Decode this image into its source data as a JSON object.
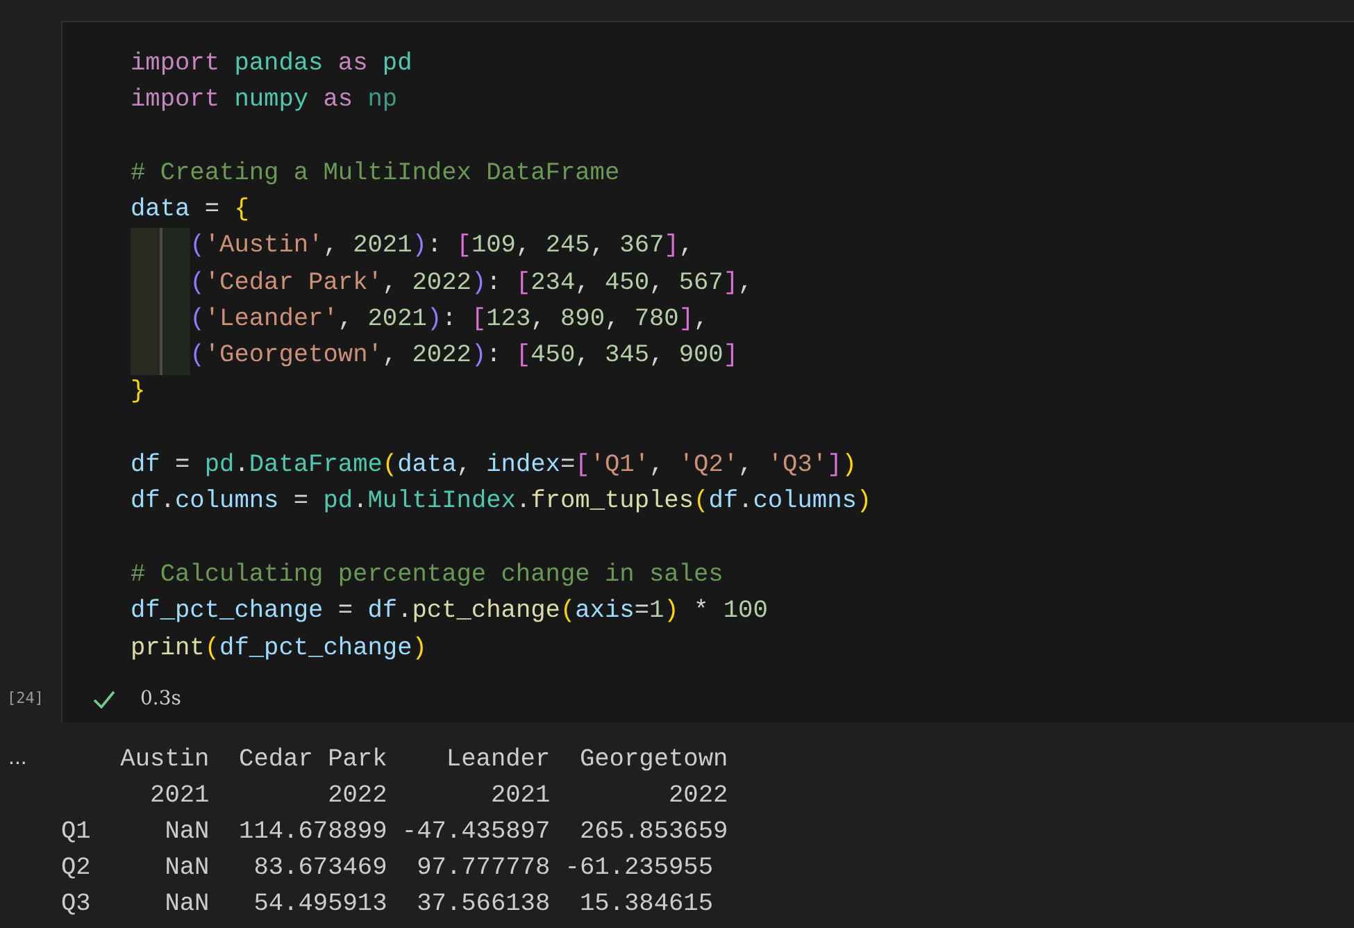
{
  "cell": {
    "execution_count": "[24]",
    "status": {
      "succeeded": true,
      "duration": "0.3s"
    },
    "code_blocks": [
      [
        {
          "indent": false,
          "tokens": [
            {
              "kind": "kw",
              "text": "import"
            },
            {
              "kind": "module",
              "text": " pandas"
            },
            {
              "kind": "kw",
              "text": " as"
            },
            {
              "kind": "module",
              "text": " pd"
            }
          ]
        },
        {
          "indent": false,
          "tokens": [
            {
              "kind": "kw",
              "text": "import"
            },
            {
              "kind": "module",
              "text": " numpy"
            },
            {
              "kind": "kw",
              "text": " as"
            },
            {
              "kind": "unused",
              "text": " np"
            }
          ]
        }
      ],
      [
        {
          "indent": false,
          "tokens": [
            {
              "kind": "comment",
              "text": "# Creating a MultiIndex DataFrame"
            }
          ]
        },
        {
          "indent": false,
          "tokens": [
            {
              "kind": "var",
              "text": "data"
            },
            {
              "kind": "plain",
              "text": " = "
            },
            {
              "kind": "b1",
              "text": "{"
            }
          ]
        },
        {
          "indent": true,
          "tokens": [
            {
              "kind": "b3",
              "text": "("
            },
            {
              "kind": "str",
              "text": "'Austin'"
            },
            {
              "kind": "plain",
              "text": ", "
            },
            {
              "kind": "num",
              "text": "2021"
            },
            {
              "kind": "b3",
              "text": ")"
            },
            {
              "kind": "plain",
              "text": ": "
            },
            {
              "kind": "b2",
              "text": "["
            },
            {
              "kind": "num",
              "text": "109"
            },
            {
              "kind": "plain",
              "text": ", "
            },
            {
              "kind": "num",
              "text": "245"
            },
            {
              "kind": "plain",
              "text": ", "
            },
            {
              "kind": "num",
              "text": "367"
            },
            {
              "kind": "b2",
              "text": "]"
            },
            {
              "kind": "plain",
              "text": ","
            }
          ]
        },
        {
          "indent": true,
          "tokens": [
            {
              "kind": "b3",
              "text": "("
            },
            {
              "kind": "str",
              "text": "'Cedar Park'"
            },
            {
              "kind": "plain",
              "text": ", "
            },
            {
              "kind": "num",
              "text": "2022"
            },
            {
              "kind": "b3",
              "text": ")"
            },
            {
              "kind": "plain",
              "text": ": "
            },
            {
              "kind": "b2",
              "text": "["
            },
            {
              "kind": "num",
              "text": "234"
            },
            {
              "kind": "plain",
              "text": ", "
            },
            {
              "kind": "num",
              "text": "450"
            },
            {
              "kind": "plain",
              "text": ", "
            },
            {
              "kind": "num",
              "text": "567"
            },
            {
              "kind": "b2",
              "text": "]"
            },
            {
              "kind": "plain",
              "text": ","
            }
          ]
        },
        {
          "indent": true,
          "tokens": [
            {
              "kind": "b3",
              "text": "("
            },
            {
              "kind": "str",
              "text": "'Leander'"
            },
            {
              "kind": "plain",
              "text": ", "
            },
            {
              "kind": "num",
              "text": "2021"
            },
            {
              "kind": "b3",
              "text": ")"
            },
            {
              "kind": "plain",
              "text": ": "
            },
            {
              "kind": "b2",
              "text": "["
            },
            {
              "kind": "num",
              "text": "123"
            },
            {
              "kind": "plain",
              "text": ", "
            },
            {
              "kind": "num",
              "text": "890"
            },
            {
              "kind": "plain",
              "text": ", "
            },
            {
              "kind": "num",
              "text": "780"
            },
            {
              "kind": "b2",
              "text": "]"
            },
            {
              "kind": "plain",
              "text": ","
            }
          ]
        },
        {
          "indent": true,
          "tokens": [
            {
              "kind": "b3",
              "text": "("
            },
            {
              "kind": "str",
              "text": "'Georgetown'"
            },
            {
              "kind": "plain",
              "text": ", "
            },
            {
              "kind": "num",
              "text": "2022"
            },
            {
              "kind": "b3",
              "text": ")"
            },
            {
              "kind": "plain",
              "text": ": "
            },
            {
              "kind": "b2",
              "text": "["
            },
            {
              "kind": "num",
              "text": "450"
            },
            {
              "kind": "plain",
              "text": ", "
            },
            {
              "kind": "num",
              "text": "345"
            },
            {
              "kind": "plain",
              "text": ", "
            },
            {
              "kind": "num",
              "text": "900"
            },
            {
              "kind": "b2",
              "text": "]"
            }
          ]
        },
        {
          "indent": false,
          "tokens": [
            {
              "kind": "b1",
              "text": "}"
            }
          ]
        }
      ],
      [
        {
          "indent": false,
          "tokens": [
            {
              "kind": "var",
              "text": "df"
            },
            {
              "kind": "plain",
              "text": " = "
            },
            {
              "kind": "module",
              "text": "pd"
            },
            {
              "kind": "plain",
              "text": "."
            },
            {
              "kind": "module",
              "text": "DataFrame"
            },
            {
              "kind": "b1",
              "text": "("
            },
            {
              "kind": "var",
              "text": "data"
            },
            {
              "kind": "plain",
              "text": ", "
            },
            {
              "kind": "var",
              "text": "index"
            },
            {
              "kind": "plain",
              "text": "="
            },
            {
              "kind": "b2",
              "text": "["
            },
            {
              "kind": "str",
              "text": "'Q1'"
            },
            {
              "kind": "plain",
              "text": ", "
            },
            {
              "kind": "str",
              "text": "'Q2'"
            },
            {
              "kind": "plain",
              "text": ", "
            },
            {
              "kind": "str",
              "text": "'Q3'"
            },
            {
              "kind": "b2",
              "text": "]"
            },
            {
              "kind": "b1",
              "text": ")"
            }
          ]
        },
        {
          "indent": false,
          "tokens": [
            {
              "kind": "var",
              "text": "df"
            },
            {
              "kind": "plain",
              "text": "."
            },
            {
              "kind": "var",
              "text": "columns"
            },
            {
              "kind": "plain",
              "text": " = "
            },
            {
              "kind": "module",
              "text": "pd"
            },
            {
              "kind": "plain",
              "text": "."
            },
            {
              "kind": "module",
              "text": "MultiIndex"
            },
            {
              "kind": "plain",
              "text": "."
            },
            {
              "kind": "func",
              "text": "from_tuples"
            },
            {
              "kind": "b1",
              "text": "("
            },
            {
              "kind": "var",
              "text": "df"
            },
            {
              "kind": "plain",
              "text": "."
            },
            {
              "kind": "var",
              "text": "columns"
            },
            {
              "kind": "b1",
              "text": ")"
            }
          ]
        }
      ],
      [
        {
          "indent": false,
          "tokens": [
            {
              "kind": "comment",
              "text": "# Calculating percentage change in sales"
            }
          ]
        },
        {
          "indent": false,
          "tokens": [
            {
              "kind": "var",
              "text": "df_pct_change"
            },
            {
              "kind": "plain",
              "text": " = "
            },
            {
              "kind": "var",
              "text": "df"
            },
            {
              "kind": "plain",
              "text": "."
            },
            {
              "kind": "func",
              "text": "pct_change"
            },
            {
              "kind": "b1",
              "text": "("
            },
            {
              "kind": "var",
              "text": "axis"
            },
            {
              "kind": "plain",
              "text": "="
            },
            {
              "kind": "num",
              "text": "1"
            },
            {
              "kind": "b1",
              "text": ")"
            },
            {
              "kind": "plain",
              "text": " * "
            },
            {
              "kind": "num",
              "text": "100"
            }
          ]
        },
        {
          "indent": false,
          "tokens": [
            {
              "kind": "func",
              "text": "print"
            },
            {
              "kind": "b1",
              "text": "("
            },
            {
              "kind": "var",
              "text": "df_pct_change"
            },
            {
              "kind": "b1",
              "text": ")"
            }
          ]
        }
      ]
    ]
  },
  "output": {
    "marker": "...",
    "lines": [
      "    Austin  Cedar Park    Leander  Georgetown",
      "      2021        2022       2021        2022",
      "Q1     NaN  114.678899 -47.435897  265.853659",
      "Q2     NaN   83.673469  97.777778 -61.235955",
      "Q3     NaN   54.495913  37.566138  15.384615"
    ]
  }
}
